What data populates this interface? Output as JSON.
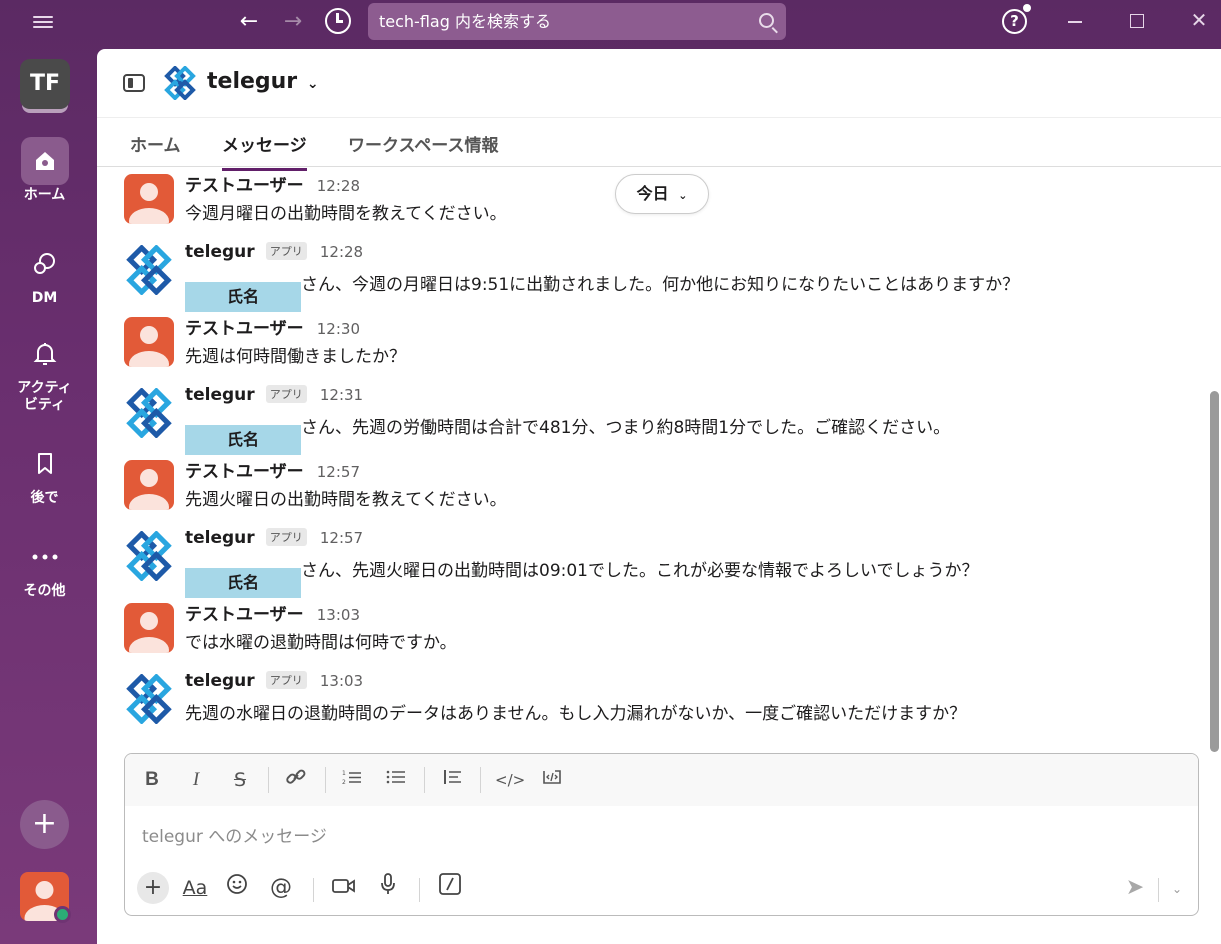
{
  "titlebar": {
    "search_placeholder": "tech-flag 内を検索する",
    "icons": [
      "menu-icon",
      "arrow-left-icon",
      "arrow-right-icon",
      "history-icon",
      "search-icon",
      "help-icon",
      "minimize-icon",
      "maximize-icon",
      "close-icon"
    ]
  },
  "workspace": {
    "initials": "TF"
  },
  "rail": {
    "home": "ホーム",
    "dm": "DM",
    "activity_1": "アクティ",
    "activity_2": "ビティ",
    "later": "後で",
    "more": "その他"
  },
  "header": {
    "title": "telegur"
  },
  "tabs": [
    "ホーム",
    "メッセージ",
    "ワークスペース情報"
  ],
  "date_divider": "今日",
  "badge_label": "アプリ",
  "mask_label": "氏名",
  "messages": [
    {
      "sender": "テストユーザー",
      "time": "12:28",
      "text": "今週月曜日の出勤時間を教えてください。"
    },
    {
      "sender": "telegur",
      "time": "12:28",
      "text": "さん、今週の月曜日は9:51に出勤されました。何か他にお知りになりたいことはありますか？"
    },
    {
      "sender": "テストユーザー",
      "time": "12:30",
      "text": "先週は何時間働きましたか？"
    },
    {
      "sender": "telegur",
      "time": "12:31",
      "text": "さん、先週の労働時間は合計で481分、つまり約8時間1分でした。ご確認ください。"
    },
    {
      "sender": "テストユーザー",
      "time": "12:57",
      "text": "先週火曜日の出勤時間を教えてください。"
    },
    {
      "sender": "telegur",
      "time": "12:57",
      "text": "さん、先週火曜日の出勤時間は09:01でした。これが必要な情報でよろしいでしょうか？"
    },
    {
      "sender": "テストユーザー",
      "time": "13:03",
      "text": "では水曜の退勤時間は何時ですか。"
    },
    {
      "sender": "telegur",
      "time": "13:03",
      "text": "先週の水曜日の退勤時間のデータはありません。もし入力漏れがないか、一度ご確認いただけますか？"
    }
  ],
  "composer": {
    "placeholder": "telegur へのメッセージ"
  },
  "colors": {
    "sidebar": "#5b2a63",
    "accent": "#611f69",
    "user_avatar": "#e25a38",
    "mask": "#a6d7e8",
    "presence": "#2bac76"
  }
}
